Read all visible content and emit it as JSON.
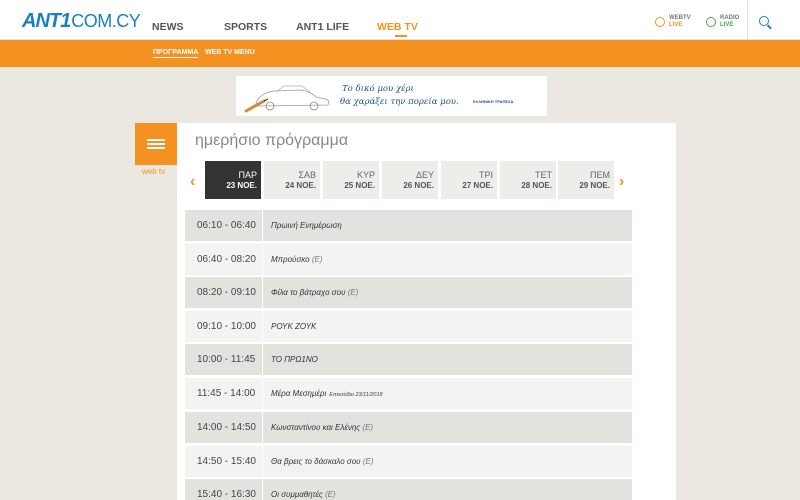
{
  "header": {
    "logo_ant": "ANT1",
    "logo_com": "COM.CY",
    "nav": [
      "NEWS",
      "SPORTS",
      "ANT1 LIFE",
      "WEB TV"
    ],
    "active_nav": "WEB TV",
    "webtv_live": {
      "line1": "WEBTV",
      "line2": "LIVE"
    },
    "radio_live": {
      "line1": "RADIO",
      "line2": "LIVE"
    }
  },
  "subnav": {
    "items": [
      "ΠΡΟΓΡΑΜΜΑ",
      "WEB TV MENU"
    ],
    "active": "ΠΡΟΓΡΑΜΜΑ"
  },
  "banner": {
    "line1": "Το δικό μου χέρι",
    "line2": "θα χαράξει την πορεία μου.",
    "bank": "ΕΛΛΗΝΙΚΗ ΤΡΑΠΕΖΑ"
  },
  "sidebar": {
    "label": "web tv"
  },
  "schedule": {
    "title": "ημερήσιο πρόγραμμα",
    "days": [
      {
        "name": "ΠΑΡ",
        "date": "23 ΝΟΕ.",
        "active": true
      },
      {
        "name": "ΣΑΒ",
        "date": "24 ΝΟΕ."
      },
      {
        "name": "ΚΥΡ",
        "date": "25 ΝΟΕ."
      },
      {
        "name": "ΔΕΥ",
        "date": "26 ΝΟΕ."
      },
      {
        "name": "ΤΡΙ",
        "date": "27 ΝΟΕ."
      },
      {
        "name": "ΤΕΤ",
        "date": "28 ΝΟΕ."
      },
      {
        "name": "ΠΕΜ",
        "date": "29 ΝΟΕ."
      }
    ],
    "rows": [
      {
        "time": "06:10 - 06:40",
        "show": "Πρωινή Ενημέρωση",
        "tag": "",
        "episode": ""
      },
      {
        "time": "06:40 - 08:20",
        "show": "Μπρούσκο",
        "tag": "(E)",
        "episode": ""
      },
      {
        "time": "08:20 - 09:10",
        "show": "Φίλα το βάτραχο σου",
        "tag": "(E)",
        "episode": ""
      },
      {
        "time": "09:10 - 10:00",
        "show": "ΡΟΥΚ ΖΟΥΚ",
        "tag": "",
        "episode": ""
      },
      {
        "time": "10:00 - 11:45",
        "show": "ΤΟ ΠΡΩ1ΝΟ",
        "tag": "",
        "episode": ""
      },
      {
        "time": "11:45 - 14:00",
        "show": "Μέρα Μεσημέρι",
        "tag": "",
        "episode": "Επεισόδιο 23/11/2018"
      },
      {
        "time": "14:00 - 14:50",
        "show": "Κωνσταντίνου και Ελένης",
        "tag": "(E)",
        "episode": ""
      },
      {
        "time": "14:50 - 15:40",
        "show": "Θα βρεις το δάσκαλο σου",
        "tag": "(E)",
        "episode": ""
      },
      {
        "time": "15:40 - 16:30",
        "show": "Οι συμμαθητές",
        "tag": "(E)",
        "episode": ""
      }
    ]
  },
  "colors": {
    "accent": "#f39220",
    "brand": "#1a80c4",
    "live_green": "#3fae49"
  }
}
